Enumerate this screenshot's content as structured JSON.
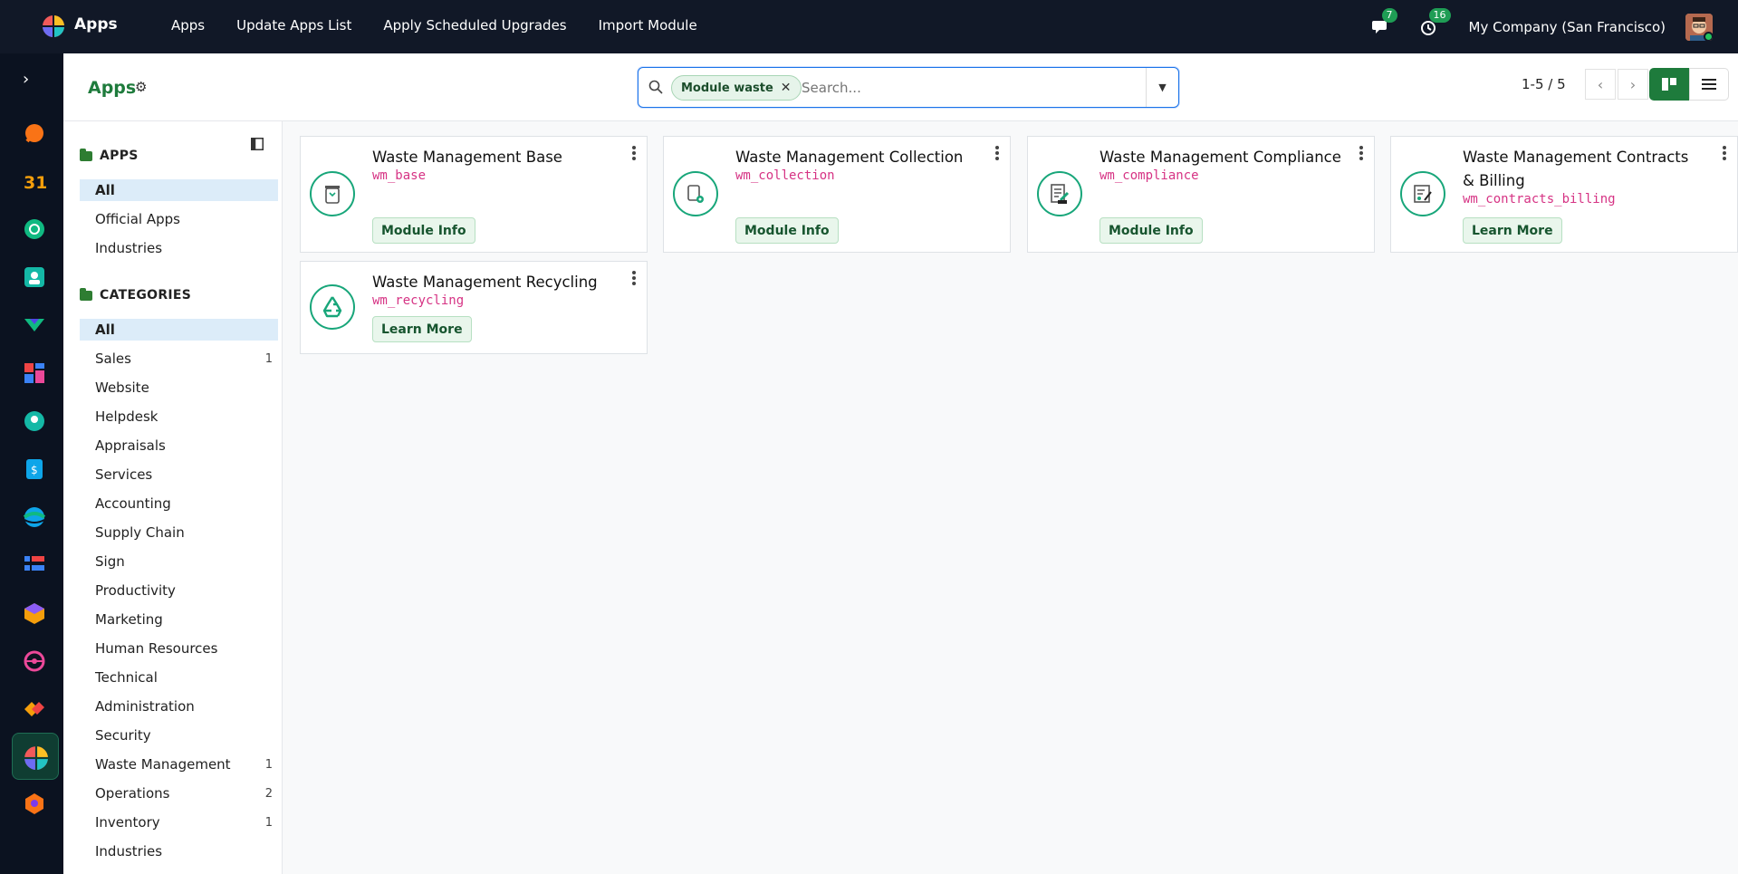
{
  "topbar": {
    "app_name": "Apps",
    "menu": [
      "Apps",
      "Update Apps List",
      "Apply Scheduled Upgrades",
      "Import Module"
    ],
    "messages_count": "7",
    "activities_count": "16",
    "company": "My Company (San Francisco)"
  },
  "control": {
    "title": "Apps",
    "facet_label": "Module waste",
    "search_placeholder": "Search...",
    "pager": "1-5 / 5"
  },
  "filter_panel": {
    "apps_heading": "APPS",
    "apps_items": [
      {
        "label": "All",
        "active": true
      },
      {
        "label": "Official Apps"
      },
      {
        "label": "Industries"
      }
    ],
    "categories_heading": "CATEGORIES",
    "categories": [
      {
        "label": "All",
        "count": "",
        "active": true
      },
      {
        "label": "Sales",
        "count": "1"
      },
      {
        "label": "Website",
        "count": ""
      },
      {
        "label": "Helpdesk",
        "count": ""
      },
      {
        "label": "Appraisals",
        "count": ""
      },
      {
        "label": "Services",
        "count": ""
      },
      {
        "label": "Accounting",
        "count": ""
      },
      {
        "label": "Supply Chain",
        "count": ""
      },
      {
        "label": "Sign",
        "count": ""
      },
      {
        "label": "Productivity",
        "count": ""
      },
      {
        "label": "Marketing",
        "count": ""
      },
      {
        "label": "Human Resources",
        "count": ""
      },
      {
        "label": "Technical",
        "count": ""
      },
      {
        "label": "Administration",
        "count": ""
      },
      {
        "label": "Security",
        "count": ""
      },
      {
        "label": "Waste Management",
        "count": "1"
      },
      {
        "label": "Operations",
        "count": "2"
      },
      {
        "label": "Inventory",
        "count": "1"
      },
      {
        "label": "Industries",
        "count": ""
      }
    ]
  },
  "modules": [
    {
      "name": "Waste Management Base",
      "technical": "wm_base",
      "button": "Module Info",
      "icon": "trash-bin-icon"
    },
    {
      "name": "Waste Management Collection",
      "technical": "wm_collection",
      "button": "Module Info",
      "icon": "collection-bin-icon"
    },
    {
      "name": "Waste Management Compliance",
      "technical": "wm_compliance",
      "button": "Module Info",
      "icon": "compliance-checklist-icon"
    },
    {
      "name": "Waste Management Contracts & Billing",
      "technical": "wm_contracts_billing",
      "button": "Learn More",
      "icon": "contract-sign-icon"
    },
    {
      "name": "Waste Management Recycling",
      "technical": "wm_recycling",
      "button": "Learn More",
      "icon": "recycle-icon"
    }
  ],
  "colors": {
    "brand_green": "#1e7b3c",
    "topbar": "#111827",
    "tech_name": "#d63384",
    "icon_ring": "#18a67a"
  }
}
